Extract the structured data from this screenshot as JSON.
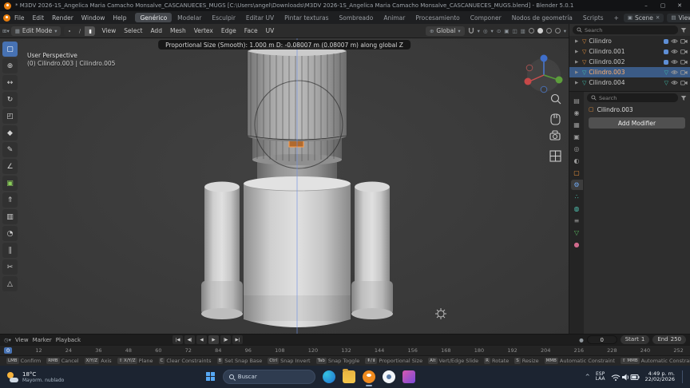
{
  "window": {
    "title": "* M3DV 2026-1S_Angelica Maria Camacho Monsalve_CASCANUECES_MUGS [C:\\Users\\angel\\Downloads\\M3DV 2026-1S_Angelica Maria Camacho Monsalve_CASCANUECES_MUGS.blend] - Blender 5.0.1",
    "minimize": "–",
    "maximize": "▢",
    "close": "✕"
  },
  "topbar": {
    "menus": [
      "File",
      "Edit",
      "Render",
      "Window",
      "Help"
    ],
    "workspaces": [
      "Genérico",
      "Modelar",
      "Esculpir",
      "Editar UV",
      "Pintar texturas",
      "Sombreado",
      "Animar",
      "Procesamiento",
      "Componer",
      "Nodos de geometría",
      "Scripts",
      "+"
    ],
    "scene": "Scene",
    "viewlayer": "ViewLayer"
  },
  "viewport_header": {
    "mode": "Edit Mode",
    "menus": [
      "View",
      "Select",
      "Add",
      "Mesh",
      "Vertex",
      "Edge",
      "Face",
      "UV"
    ],
    "orientation": "Global"
  },
  "operator_hint": "Proportional Size (Smooth): 1.000 m   D: -0.08007 m (0.08007 m) along global Z",
  "viewport": {
    "perspective": "User Perspective",
    "object_info": "(0) Cilindro.003 | Cilindro.005"
  },
  "outliner": {
    "search_placeholder": "Search",
    "items": [
      {
        "label": "Cilindro"
      },
      {
        "label": "Cilindro.001"
      },
      {
        "label": "Cilindro.002"
      },
      {
        "label": "Cilindro.003"
      },
      {
        "label": "Cilindro.004"
      }
    ]
  },
  "properties": {
    "search_placeholder": "Search",
    "object_name": "Cilindro.003",
    "add_modifier": "Add Modifier"
  },
  "timeline": {
    "menus": [
      "View",
      "Marker",
      "Playback"
    ],
    "current_frame": "0",
    "start_label": "Start",
    "start_value": "1",
    "end_label": "End",
    "end_value": "250",
    "ticks": [
      "0",
      "12",
      "24",
      "36",
      "48",
      "60",
      "72",
      "84",
      "96",
      "108",
      "120",
      "132",
      "144",
      "156",
      "168",
      "180",
      "192",
      "204",
      "216",
      "228",
      "240",
      "252"
    ]
  },
  "status_hints": [
    {
      "badge": "LMB",
      "label": "Confirm"
    },
    {
      "badge": "RMB",
      "label": "Cancel"
    },
    {
      "badge": "X/Y/Z",
      "label": "Axis"
    },
    {
      "badge": "⇧ X/Y/Z",
      "label": "Plane"
    },
    {
      "badge": "C",
      "label": "Clear Constraints"
    },
    {
      "badge": "B",
      "label": "Set Snap Base"
    },
    {
      "badge": "Ctrl",
      "label": "Snap Invert"
    },
    {
      "badge": "Tab",
      "label": "Snap Toggle"
    },
    {
      "badge": "⇞/⇟",
      "label": "Proportional Size"
    },
    {
      "badge": "Alt",
      "label": "Vert/Edge Slide"
    },
    {
      "badge": "R",
      "label": "Rotate"
    },
    {
      "badge": "S",
      "label": "Resize"
    },
    {
      "badge": "MMB",
      "label": "Automatic Constraint"
    },
    {
      "badge": "⇧ MMB",
      "label": "Automatic Constraint Plane"
    }
  ],
  "taskbar": {
    "weather_temp": "18°C",
    "weather_desc": "Mayorm. nublado",
    "search_placeholder": "Buscar",
    "lang_primary": "ESP",
    "lang_secondary": "LAA",
    "time": "4:49 p. m.",
    "date": "22/02/2026"
  },
  "colors": {
    "accent_blue": "#4772b3",
    "object_orange": "#e8913c",
    "selected_row_blue": "#3b5b86",
    "taskbar_bg": "#1c2431"
  }
}
